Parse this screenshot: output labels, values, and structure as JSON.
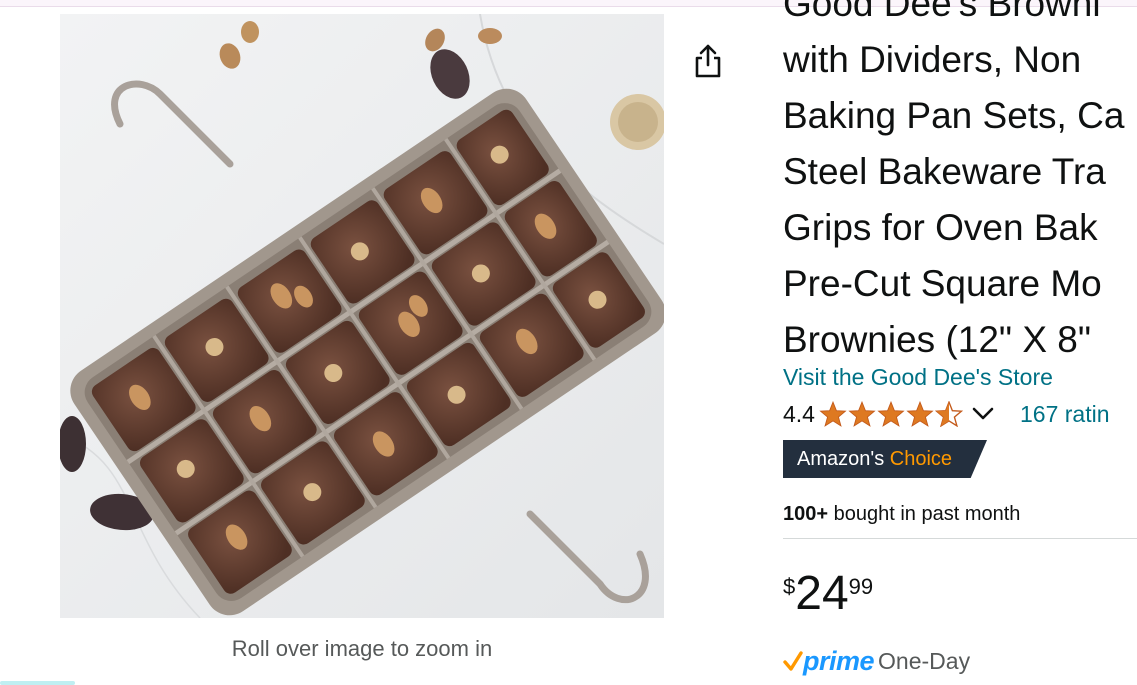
{
  "product_image": {
    "alt": "Brownie pan with dividers"
  },
  "zoom_hint": "Roll over image to zoom in",
  "share": {
    "icon": "share-icon"
  },
  "title_lines": [
    "Good Dee's Browni",
    "with Dividers, Non",
    "Baking Pan Sets, Ca",
    "Steel Bakeware Tra",
    "Grips for Oven Bak",
    "Pre-Cut Square Mo",
    "Brownies (12\" X 8\""
  ],
  "store_link": "Visit the Good Dee's Store",
  "rating": {
    "value": "4.4",
    "stars": 4.4,
    "count_text": "167 ratin",
    "star_color": "#de7921"
  },
  "badge": {
    "brand": "Amazon's",
    "choice": "Choice"
  },
  "bought": {
    "count": "100+",
    "text": "bought in past month"
  },
  "price": {
    "symbol": "$",
    "whole": "24",
    "fraction": "99"
  },
  "prime": {
    "label": "prime",
    "delivery": "One-Day"
  },
  "colors": {
    "link": "#007185",
    "prime": "#1a98ff",
    "badge_bg": "#232f3e",
    "badge_accent": "#ff9900"
  }
}
